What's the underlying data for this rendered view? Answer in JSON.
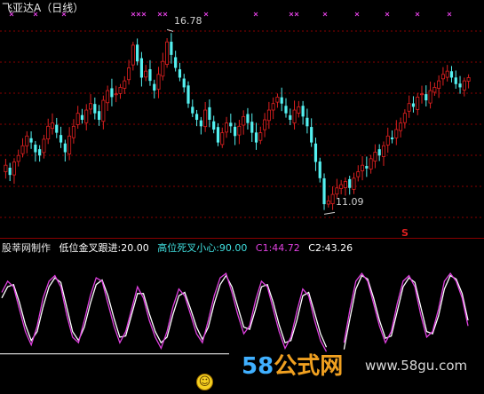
{
  "main_panel": {
    "title": "飞亚达A（日线）",
    "max_label": "16.78",
    "min_label": "11.09",
    "s_marker": "S",
    "colors": {
      "up": "#e02020",
      "down": "#54f0f0",
      "title": "#e8e8e8",
      "grid": "#8a0000",
      "cross": "#e040e0"
    }
  },
  "indicator_panel": {
    "brand": "股莘网制作",
    "items": [
      {
        "label": "低位金叉跟进:20.00",
        "color": "#ffffff"
      },
      {
        "label": "高位死叉小心:90.00",
        "color": "#40e0e0"
      },
      {
        "label": "C1:44.72",
        "color": "#e040e0"
      },
      {
        "label": "C2:43.26",
        "color": "#ffffff"
      }
    ],
    "smiley": "☺"
  },
  "watermark": {
    "logo_digits": "58",
    "logo_text": "公式网",
    "url": "www.58gu.com"
  },
  "chart_data": {
    "type": "candlestick",
    "main": {
      "high_mark": 16.78,
      "low_mark": 11.09,
      "close_series": [
        12.6,
        12.3,
        12.7,
        12.9,
        13.2,
        13.5,
        13.3,
        13.0,
        12.9,
        13.4,
        13.8,
        13.9,
        13.6,
        13.3,
        13.0,
        13.5,
        13.8,
        14.2,
        14.0,
        14.3,
        14.5,
        14.2,
        14.0,
        14.6,
        14.9,
        14.7,
        14.8,
        15.0,
        15.2,
        15.6,
        16.3,
        15.8,
        15.3,
        15.5,
        15.2,
        14.9,
        15.4,
        15.8,
        16.4,
        16.0,
        15.6,
        15.3,
        15.0,
        14.5,
        14.2,
        14.0,
        13.8,
        14.3,
        14.0,
        13.7,
        13.3,
        13.6,
        13.9,
        13.8,
        13.5,
        13.8,
        14.1,
        13.9,
        13.6,
        13.3,
        13.6,
        14.0,
        14.3,
        14.5,
        14.7,
        14.5,
        14.2,
        14.0,
        14.3,
        14.4,
        14.1,
        13.8,
        13.3,
        12.7,
        12.2,
        11.4,
        11.5,
        11.7,
        11.9,
        12.0,
        12.1,
        11.9,
        12.2,
        12.4,
        12.6,
        12.5,
        12.8,
        13.0,
        12.9,
        13.2,
        13.5,
        13.4,
        13.7,
        13.9,
        14.2,
        14.5,
        14.4,
        14.7,
        14.8,
        14.6,
        14.9,
        15.0,
        15.2,
        15.4,
        15.5,
        15.3,
        15.1,
        15.0,
        15.2,
        15.3
      ],
      "cross_markers_row": true
    },
    "indicator": {
      "reference_levels": [
        20,
        90
      ],
      "c1_last": 44.72,
      "c2_last": 43.26,
      "c1_series": [
        75,
        85,
        80,
        60,
        40,
        28,
        45,
        70,
        85,
        90,
        80,
        55,
        35,
        30,
        50,
        72,
        88,
        85,
        65,
        45,
        30,
        40,
        60,
        80,
        70,
        50,
        35,
        25,
        40,
        62,
        78,
        72,
        55,
        38,
        30,
        50,
        72,
        88,
        92,
        75,
        55,
        38,
        45,
        68,
        85,
        80,
        60,
        40,
        25,
        35,
        58,
        78,
        72,
        50,
        32,
        22,
        15,
        8,
        30,
        60,
        85,
        92,
        85,
        65,
        45,
        30,
        40,
        65,
        85,
        90,
        80,
        55,
        35,
        40,
        60,
        85,
        92,
        85,
        70,
        45
      ],
      "c2_series": [
        70,
        80,
        82,
        66,
        46,
        32,
        40,
        62,
        80,
        88,
        84,
        62,
        40,
        32,
        44,
        65,
        82,
        86,
        72,
        52,
        35,
        36,
        55,
        74,
        74,
        56,
        40,
        30,
        35,
        55,
        72,
        75,
        60,
        44,
        33,
        44,
        65,
        82,
        90,
        80,
        62,
        44,
        42,
        60,
        80,
        82,
        66,
        46,
        30,
        32,
        50,
        72,
        75,
        57,
        38,
        26,
        18,
        10,
        24,
        52,
        78,
        90,
        87,
        70,
        50,
        34,
        36,
        58,
        80,
        88,
        84,
        62,
        40,
        38,
        54,
        78,
        90,
        87,
        74,
        50
      ]
    }
  }
}
